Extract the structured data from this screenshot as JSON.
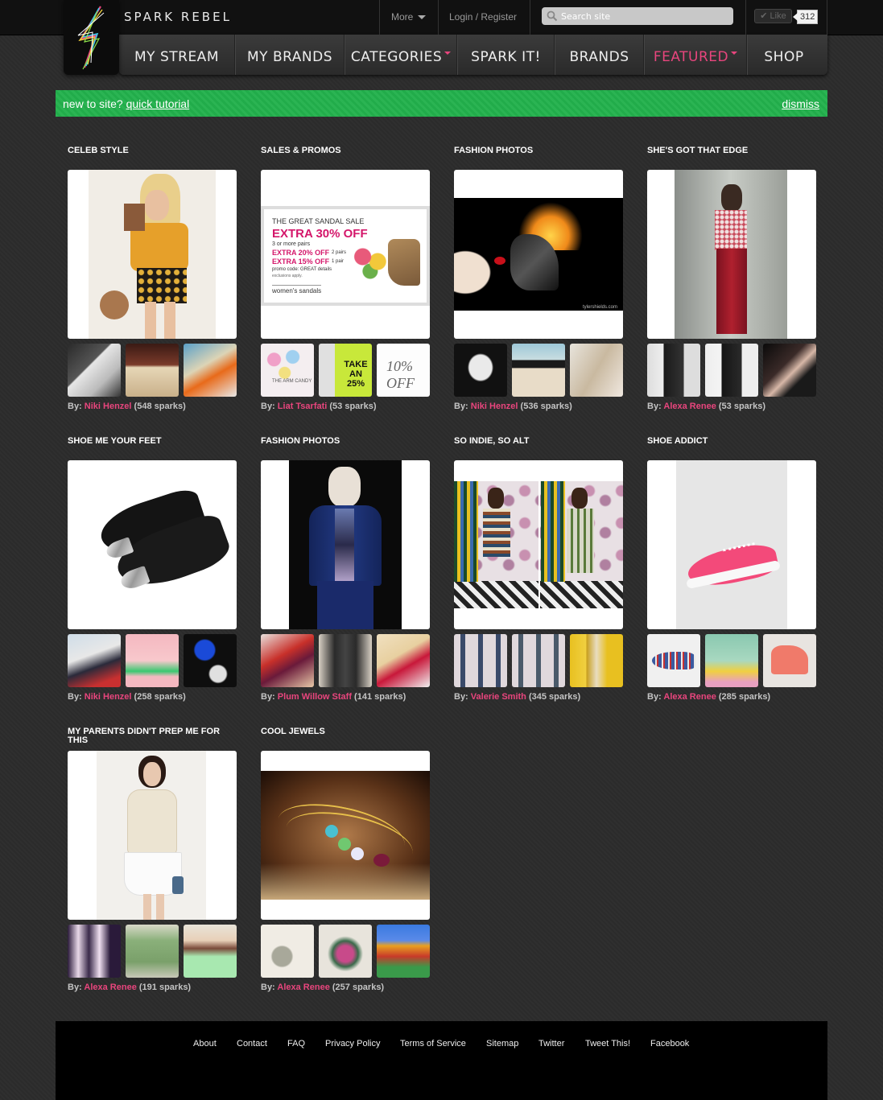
{
  "site": {
    "brand": "SPARK REBEL"
  },
  "topbar": {
    "more_label": "More",
    "login_label": "Login / Register",
    "search_placeholder": "Search site",
    "like_label": "Like",
    "like_count": "312"
  },
  "nav": {
    "items": [
      {
        "label": "MY STREAM"
      },
      {
        "label": "MY BRANDS"
      },
      {
        "label": "CATEGORIES"
      },
      {
        "label": "SPARK IT!"
      },
      {
        "label": "BRANDS"
      },
      {
        "label": "FEATURED"
      },
      {
        "label": "SHOP"
      }
    ]
  },
  "tutorial": {
    "prefix": "new to site? ",
    "link": "quick tutorial",
    "dismiss": "dismiss"
  },
  "colors": {
    "accent": "#e8457d",
    "tutorial_green": "#22b14c"
  },
  "cards": [
    {
      "title": "CELEB STYLE",
      "by": "By:",
      "author": "Niki Henzel",
      "sparks": "(548 sparks)"
    },
    {
      "title": "SALES & PROMOS",
      "by": "By:",
      "author": "Liat Tsarfati",
      "sparks": "(53 sparks)",
      "promo": {
        "heading": "THE GREAT SANDAL SALE",
        "big": "EXTRA 30% OFF",
        "line1": "3 or more pairs",
        "line2": "EXTRA 20% OFF",
        "line2b": "2 pairs",
        "line3": "EXTRA 15% OFF",
        "line3b": "1 pair",
        "code": "promo code: GREAT details",
        "excl": "exclusions apply.",
        "footer": "women's sandals"
      },
      "thumb_texts": [
        "THE ARM CANDY",
        "TAKE AN 25%",
        "10% OFF"
      ]
    },
    {
      "title": "FASHION PHOTOS",
      "by": "By:",
      "author": "Niki Henzel",
      "sparks": "(536 sparks)",
      "watermark": "tylershields.com"
    },
    {
      "title": "SHE'S GOT THAT EDGE",
      "by": "By:",
      "author": "Alexa Renee",
      "sparks": "(53 sparks)"
    },
    {
      "title": "SHOE ME YOUR FEET",
      "by": "By:",
      "author": "Niki Henzel",
      "sparks": "(258 sparks)"
    },
    {
      "title": "FASHION PHOTOS",
      "by": "By:",
      "author": "Plum Willow Staff",
      "sparks": "(141 sparks)"
    },
    {
      "title": "SO INDIE, SO ALT",
      "by": "By:",
      "author": "Valerie Smith",
      "sparks": "(345 sparks)"
    },
    {
      "title": "SHOE ADDICT",
      "by": "By:",
      "author": "Alexa Renee",
      "sparks": "(285 sparks)"
    },
    {
      "title": "MY PARENTS DIDN'T PREP ME FOR THIS",
      "by": "By:",
      "author": "Alexa Renee",
      "sparks": "(191 sparks)"
    },
    {
      "title": "COOL JEWELS",
      "by": "By:",
      "author": "Alexa Renee",
      "sparks": "(257 sparks)"
    }
  ],
  "footer": {
    "links": [
      "About",
      "Contact",
      "FAQ",
      "Privacy Policy",
      "Terms of Service",
      "Sitemap",
      "Twitter",
      "Tweet This!",
      "Facebook"
    ]
  }
}
